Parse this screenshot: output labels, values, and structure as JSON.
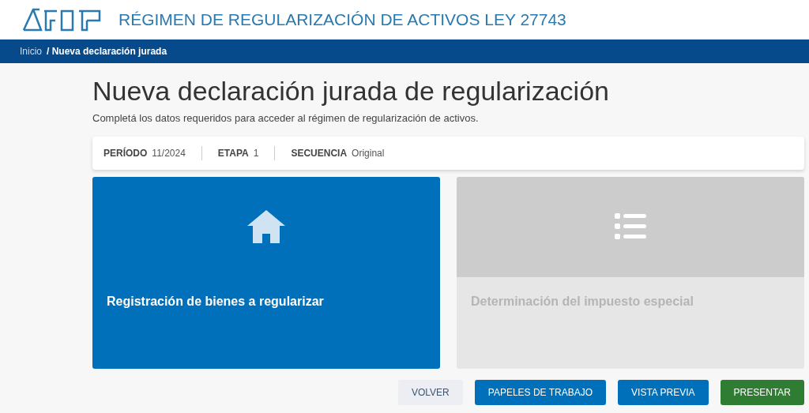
{
  "header": {
    "title": "RÉGIMEN DE REGULARIZACIÓN DE ACTIVOS LEY 27743"
  },
  "breadcrumb": [
    {
      "label": "Inicio",
      "current": false
    },
    {
      "label": "/ Nueva declaración jurada",
      "current": true
    }
  ],
  "page": {
    "title": "Nueva declaración jurada de regularización",
    "subtitle": "Completá los datos requeridos para acceder al régimen de regularización de activos."
  },
  "info": [
    {
      "label": "PERÍODO",
      "value": "11/2024"
    },
    {
      "label": "ETAPA",
      "value": "1"
    },
    {
      "label": "SECUENCIA",
      "value": "Original"
    }
  ],
  "cards": [
    {
      "label": "Registración de bienes a regularizar",
      "disabled": false
    },
    {
      "label": "Determinación del impuesto especial",
      "disabled": true
    }
  ],
  "buttons": [
    {
      "label": "VOLVER",
      "kind": "secondary"
    },
    {
      "label": "PAPELES DE TRABAJO",
      "kind": "primary"
    },
    {
      "label": "VISTA PREVIA",
      "kind": "primary"
    },
    {
      "label": "PRESENTAR",
      "kind": "success"
    }
  ]
}
